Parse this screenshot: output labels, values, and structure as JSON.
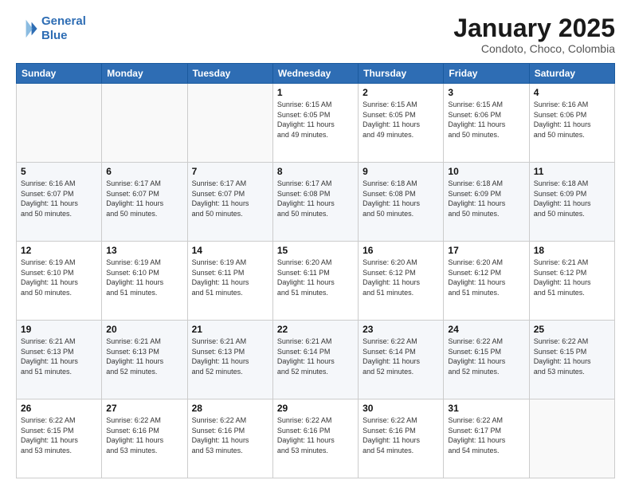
{
  "logo": {
    "line1": "General",
    "line2": "Blue"
  },
  "header": {
    "title": "January 2025",
    "subtitle": "Condoto, Choco, Colombia"
  },
  "weekdays": [
    "Sunday",
    "Monday",
    "Tuesday",
    "Wednesday",
    "Thursday",
    "Friday",
    "Saturday"
  ],
  "weeks": [
    [
      {
        "day": "",
        "info": ""
      },
      {
        "day": "",
        "info": ""
      },
      {
        "day": "",
        "info": ""
      },
      {
        "day": "1",
        "info": "Sunrise: 6:15 AM\nSunset: 6:05 PM\nDaylight: 11 hours\nand 49 minutes."
      },
      {
        "day": "2",
        "info": "Sunrise: 6:15 AM\nSunset: 6:05 PM\nDaylight: 11 hours\nand 49 minutes."
      },
      {
        "day": "3",
        "info": "Sunrise: 6:15 AM\nSunset: 6:06 PM\nDaylight: 11 hours\nand 50 minutes."
      },
      {
        "day": "4",
        "info": "Sunrise: 6:16 AM\nSunset: 6:06 PM\nDaylight: 11 hours\nand 50 minutes."
      }
    ],
    [
      {
        "day": "5",
        "info": "Sunrise: 6:16 AM\nSunset: 6:07 PM\nDaylight: 11 hours\nand 50 minutes."
      },
      {
        "day": "6",
        "info": "Sunrise: 6:17 AM\nSunset: 6:07 PM\nDaylight: 11 hours\nand 50 minutes."
      },
      {
        "day": "7",
        "info": "Sunrise: 6:17 AM\nSunset: 6:07 PM\nDaylight: 11 hours\nand 50 minutes."
      },
      {
        "day": "8",
        "info": "Sunrise: 6:17 AM\nSunset: 6:08 PM\nDaylight: 11 hours\nand 50 minutes."
      },
      {
        "day": "9",
        "info": "Sunrise: 6:18 AM\nSunset: 6:08 PM\nDaylight: 11 hours\nand 50 minutes."
      },
      {
        "day": "10",
        "info": "Sunrise: 6:18 AM\nSunset: 6:09 PM\nDaylight: 11 hours\nand 50 minutes."
      },
      {
        "day": "11",
        "info": "Sunrise: 6:18 AM\nSunset: 6:09 PM\nDaylight: 11 hours\nand 50 minutes."
      }
    ],
    [
      {
        "day": "12",
        "info": "Sunrise: 6:19 AM\nSunset: 6:10 PM\nDaylight: 11 hours\nand 50 minutes."
      },
      {
        "day": "13",
        "info": "Sunrise: 6:19 AM\nSunset: 6:10 PM\nDaylight: 11 hours\nand 51 minutes."
      },
      {
        "day": "14",
        "info": "Sunrise: 6:19 AM\nSunset: 6:11 PM\nDaylight: 11 hours\nand 51 minutes."
      },
      {
        "day": "15",
        "info": "Sunrise: 6:20 AM\nSunset: 6:11 PM\nDaylight: 11 hours\nand 51 minutes."
      },
      {
        "day": "16",
        "info": "Sunrise: 6:20 AM\nSunset: 6:12 PM\nDaylight: 11 hours\nand 51 minutes."
      },
      {
        "day": "17",
        "info": "Sunrise: 6:20 AM\nSunset: 6:12 PM\nDaylight: 11 hours\nand 51 minutes."
      },
      {
        "day": "18",
        "info": "Sunrise: 6:21 AM\nSunset: 6:12 PM\nDaylight: 11 hours\nand 51 minutes."
      }
    ],
    [
      {
        "day": "19",
        "info": "Sunrise: 6:21 AM\nSunset: 6:13 PM\nDaylight: 11 hours\nand 51 minutes."
      },
      {
        "day": "20",
        "info": "Sunrise: 6:21 AM\nSunset: 6:13 PM\nDaylight: 11 hours\nand 52 minutes."
      },
      {
        "day": "21",
        "info": "Sunrise: 6:21 AM\nSunset: 6:13 PM\nDaylight: 11 hours\nand 52 minutes."
      },
      {
        "day": "22",
        "info": "Sunrise: 6:21 AM\nSunset: 6:14 PM\nDaylight: 11 hours\nand 52 minutes."
      },
      {
        "day": "23",
        "info": "Sunrise: 6:22 AM\nSunset: 6:14 PM\nDaylight: 11 hours\nand 52 minutes."
      },
      {
        "day": "24",
        "info": "Sunrise: 6:22 AM\nSunset: 6:15 PM\nDaylight: 11 hours\nand 52 minutes."
      },
      {
        "day": "25",
        "info": "Sunrise: 6:22 AM\nSunset: 6:15 PM\nDaylight: 11 hours\nand 53 minutes."
      }
    ],
    [
      {
        "day": "26",
        "info": "Sunrise: 6:22 AM\nSunset: 6:15 PM\nDaylight: 11 hours\nand 53 minutes."
      },
      {
        "day": "27",
        "info": "Sunrise: 6:22 AM\nSunset: 6:16 PM\nDaylight: 11 hours\nand 53 minutes."
      },
      {
        "day": "28",
        "info": "Sunrise: 6:22 AM\nSunset: 6:16 PM\nDaylight: 11 hours\nand 53 minutes."
      },
      {
        "day": "29",
        "info": "Sunrise: 6:22 AM\nSunset: 6:16 PM\nDaylight: 11 hours\nand 53 minutes."
      },
      {
        "day": "30",
        "info": "Sunrise: 6:22 AM\nSunset: 6:16 PM\nDaylight: 11 hours\nand 54 minutes."
      },
      {
        "day": "31",
        "info": "Sunrise: 6:22 AM\nSunset: 6:17 PM\nDaylight: 11 hours\nand 54 minutes."
      },
      {
        "day": "",
        "info": ""
      }
    ]
  ]
}
